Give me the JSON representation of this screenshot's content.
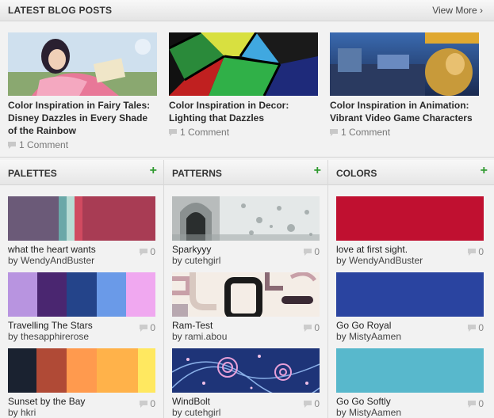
{
  "blog": {
    "title": "LATEST BLOG POSTS",
    "view_more": "View More ›",
    "posts": [
      {
        "title": "Color Inspiration in Fairy Tales: Disney Dazzles in Every Shade of the Rainbow",
        "comments": "1 Comment"
      },
      {
        "title": "Color Inspiration in Decor: Lighting that Dazzles",
        "comments": "1 Comment"
      },
      {
        "title": "Color Inspiration in Animation: Vibrant Video Game Characters",
        "comments": "1 Comment"
      }
    ]
  },
  "palettes": {
    "title": "PALETTES",
    "plus": "+",
    "items": [
      {
        "name": "what the heart wants",
        "by": "by WendyAndBuster",
        "count": "0",
        "colors": [
          "#6b5a78",
          "#6aa8a8",
          "#b8dcd4",
          "#d04a60",
          "#a83c54"
        ]
      },
      {
        "name": "Travelling The Stars",
        "by": "by thesapphirerose",
        "count": "0",
        "colors": [
          "#b894e0",
          "#4a2670",
          "#24448a",
          "#6a9ae8",
          "#f0a8f0"
        ]
      },
      {
        "name": "Sunset by the Bay",
        "by": "by hkri",
        "count": "0",
        "colors": [
          "#1a2230",
          "#b04a36",
          "#ff9a4e",
          "#ffb24a",
          "#ffe860"
        ]
      }
    ]
  },
  "patterns": {
    "title": "PATTERNS",
    "plus": "+",
    "items": [
      {
        "name": "Sparkyyy",
        "by": "by cutehgirl",
        "count": "0"
      },
      {
        "name": "Ram-Test",
        "by": "by rami.abou",
        "count": "0"
      },
      {
        "name": "WindBolt",
        "by": "by cutehgirl",
        "count": "0"
      }
    ]
  },
  "colors": {
    "title": "COLORS",
    "plus": "+",
    "items": [
      {
        "name": "love at first sight.",
        "by": "by WendyAndBuster",
        "count": "0",
        "color": "#c01030"
      },
      {
        "name": "Go Go Royal",
        "by": "by MistyAamen",
        "count": "0",
        "color": "#2a44a0"
      },
      {
        "name": "Go Go Softly",
        "by": "by MistyAamen",
        "count": "0",
        "color": "#58b8cc"
      }
    ]
  }
}
